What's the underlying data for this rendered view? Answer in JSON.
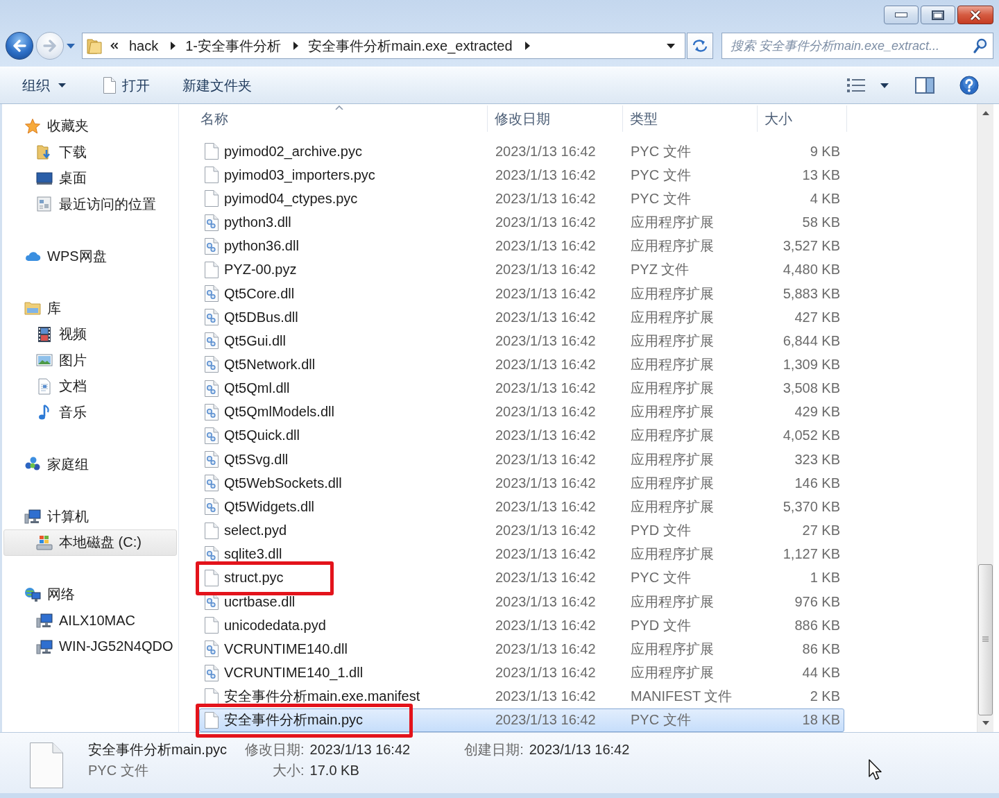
{
  "nav": {
    "back": {
      "disabled": false
    },
    "forward": {
      "disabled": true
    }
  },
  "address": {
    "breadcrumbs": [
      "hack",
      "1-安全事件分析",
      "安全事件分析main.exe_extracted"
    ]
  },
  "search": {
    "placeholder": "搜索 安全事件分析main.exe_extract..."
  },
  "toolbar": {
    "items": [
      {
        "kind": "menu",
        "label": "组织"
      },
      {
        "kind": "open",
        "label": "打开"
      },
      {
        "kind": "plain",
        "label": "新建文件夹"
      }
    ]
  },
  "sidebar": {
    "groups": [
      {
        "kind": "favorites",
        "label": "收藏夹",
        "selected": false,
        "children": [
          {
            "kind": "downloads",
            "label": "下载",
            "selected": false
          },
          {
            "kind": "desktop",
            "label": "桌面",
            "selected": false
          },
          {
            "kind": "recent",
            "label": "最近访问的位置",
            "selected": false
          }
        ]
      },
      {
        "kind": "cloud",
        "label": "WPS网盘",
        "selected": false
      },
      {
        "kind": "library",
        "label": "库",
        "selected": false,
        "children": [
          {
            "kind": "videos",
            "label": "视频",
            "selected": false
          },
          {
            "kind": "pictures",
            "label": "图片",
            "selected": false
          },
          {
            "kind": "documents",
            "label": "文档",
            "selected": false
          },
          {
            "kind": "music",
            "label": "音乐",
            "selected": false
          }
        ]
      },
      {
        "kind": "homegroup",
        "label": "家庭组",
        "selected": false
      },
      {
        "kind": "computer",
        "label": "计算机",
        "selected": false,
        "children": [
          {
            "kind": "drive",
            "label": "本地磁盘 (C:)",
            "selected": true
          }
        ]
      },
      {
        "kind": "network",
        "label": "网络",
        "selected": false,
        "children": [
          {
            "kind": "pc",
            "label": "AILX10MAC",
            "selected": false
          },
          {
            "kind": "pc",
            "label": "WIN-JG52N4QDO",
            "selected": false
          }
        ]
      }
    ]
  },
  "columns": [
    {
      "label": "名称",
      "sorted": true
    },
    {
      "label": "修改日期",
      "sorted": false
    },
    {
      "label": "类型",
      "sorted": false
    },
    {
      "label": "大小",
      "sorted": false
    }
  ],
  "rows": [
    {
      "kind": "file",
      "name": "pyimod02_archive.pyc",
      "date": "2023/1/13 16:42",
      "type": "PYC 文件",
      "size": "9 KB",
      "selected": false,
      "highlighted": false
    },
    {
      "kind": "file",
      "name": "pyimod03_importers.pyc",
      "date": "2023/1/13 16:42",
      "type": "PYC 文件",
      "size": "13 KB",
      "selected": false,
      "highlighted": false
    },
    {
      "kind": "file",
      "name": "pyimod04_ctypes.pyc",
      "date": "2023/1/13 16:42",
      "type": "PYC 文件",
      "size": "4 KB",
      "selected": false,
      "highlighted": false
    },
    {
      "kind": "dll",
      "name": "python3.dll",
      "date": "2023/1/13 16:42",
      "type": "应用程序扩展",
      "size": "58 KB",
      "selected": false,
      "highlighted": false
    },
    {
      "kind": "dll",
      "name": "python36.dll",
      "date": "2023/1/13 16:42",
      "type": "应用程序扩展",
      "size": "3,527 KB",
      "selected": false,
      "highlighted": false
    },
    {
      "kind": "file",
      "name": "PYZ-00.pyz",
      "date": "2023/1/13 16:42",
      "type": "PYZ 文件",
      "size": "4,480 KB",
      "selected": false,
      "highlighted": false
    },
    {
      "kind": "dll",
      "name": "Qt5Core.dll",
      "date": "2023/1/13 16:42",
      "type": "应用程序扩展",
      "size": "5,883 KB",
      "selected": false,
      "highlighted": false
    },
    {
      "kind": "dll",
      "name": "Qt5DBus.dll",
      "date": "2023/1/13 16:42",
      "type": "应用程序扩展",
      "size": "427 KB",
      "selected": false,
      "highlighted": false
    },
    {
      "kind": "dll",
      "name": "Qt5Gui.dll",
      "date": "2023/1/13 16:42",
      "type": "应用程序扩展",
      "size": "6,844 KB",
      "selected": false,
      "highlighted": false
    },
    {
      "kind": "dll",
      "name": "Qt5Network.dll",
      "date": "2023/1/13 16:42",
      "type": "应用程序扩展",
      "size": "1,309 KB",
      "selected": false,
      "highlighted": false
    },
    {
      "kind": "dll",
      "name": "Qt5Qml.dll",
      "date": "2023/1/13 16:42",
      "type": "应用程序扩展",
      "size": "3,508 KB",
      "selected": false,
      "highlighted": false
    },
    {
      "kind": "dll",
      "name": "Qt5QmlModels.dll",
      "date": "2023/1/13 16:42",
      "type": "应用程序扩展",
      "size": "429 KB",
      "selected": false,
      "highlighted": false
    },
    {
      "kind": "dll",
      "name": "Qt5Quick.dll",
      "date": "2023/1/13 16:42",
      "type": "应用程序扩展",
      "size": "4,052 KB",
      "selected": false,
      "highlighted": false
    },
    {
      "kind": "dll",
      "name": "Qt5Svg.dll",
      "date": "2023/1/13 16:42",
      "type": "应用程序扩展",
      "size": "323 KB",
      "selected": false,
      "highlighted": false
    },
    {
      "kind": "dll",
      "name": "Qt5WebSockets.dll",
      "date": "2023/1/13 16:42",
      "type": "应用程序扩展",
      "size": "146 KB",
      "selected": false,
      "highlighted": false
    },
    {
      "kind": "dll",
      "name": "Qt5Widgets.dll",
      "date": "2023/1/13 16:42",
      "type": "应用程序扩展",
      "size": "5,370 KB",
      "selected": false,
      "highlighted": false
    },
    {
      "kind": "file",
      "name": "select.pyd",
      "date": "2023/1/13 16:42",
      "type": "PYD 文件",
      "size": "27 KB",
      "selected": false,
      "highlighted": false
    },
    {
      "kind": "dll",
      "name": "sqlite3.dll",
      "date": "2023/1/13 16:42",
      "type": "应用程序扩展",
      "size": "1,127 KB",
      "selected": false,
      "highlighted": false
    },
    {
      "kind": "file",
      "name": "struct.pyc",
      "date": "2023/1/13 16:42",
      "type": "PYC 文件",
      "size": "1 KB",
      "selected": false,
      "highlighted": true
    },
    {
      "kind": "dll",
      "name": "ucrtbase.dll",
      "date": "2023/1/13 16:42",
      "type": "应用程序扩展",
      "size": "976 KB",
      "selected": false,
      "highlighted": false
    },
    {
      "kind": "file",
      "name": "unicodedata.pyd",
      "date": "2023/1/13 16:42",
      "type": "PYD 文件",
      "size": "886 KB",
      "selected": false,
      "highlighted": false
    },
    {
      "kind": "dll",
      "name": "VCRUNTIME140.dll",
      "date": "2023/1/13 16:42",
      "type": "应用程序扩展",
      "size": "86 KB",
      "selected": false,
      "highlighted": false
    },
    {
      "kind": "dll",
      "name": "VCRUNTIME140_1.dll",
      "date": "2023/1/13 16:42",
      "type": "应用程序扩展",
      "size": "44 KB",
      "selected": false,
      "highlighted": false
    },
    {
      "kind": "file",
      "name": "安全事件分析main.exe.manifest",
      "date": "2023/1/13 16:42",
      "type": "MANIFEST 文件",
      "size": "2 KB",
      "selected": false,
      "highlighted": false
    },
    {
      "kind": "file",
      "name": "安全事件分析main.pyc",
      "date": "2023/1/13 16:42",
      "type": "PYC 文件",
      "size": "18 KB",
      "selected": true,
      "highlighted": true
    }
  ],
  "details": {
    "name": "安全事件分析main.pyc",
    "type": "PYC 文件",
    "fields": [
      {
        "label": "修改日期:",
        "value": "2023/1/13 16:42"
      },
      {
        "label": "大小:",
        "value": "17.0 KB"
      },
      {
        "label": "创建日期:",
        "value": "2023/1/13 16:42"
      }
    ]
  }
}
